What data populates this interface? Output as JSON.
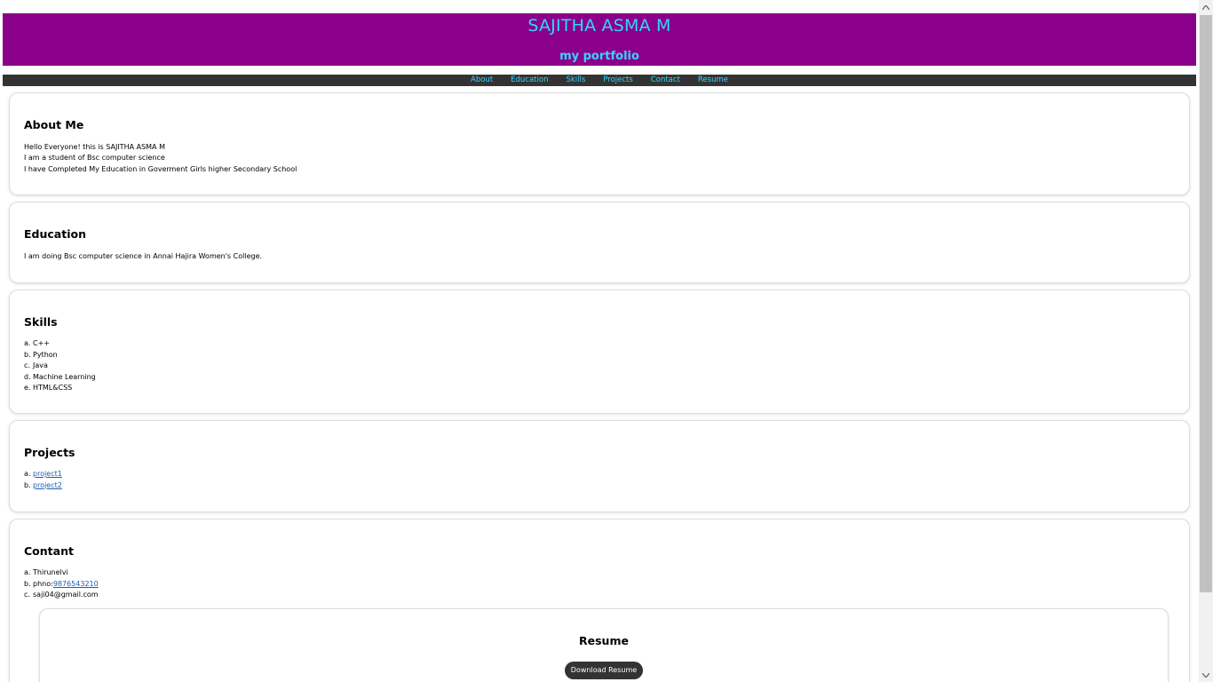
{
  "header": {
    "title": "SAJITHA ASMA M",
    "subtitle": "my portfolio"
  },
  "nav": {
    "items": [
      {
        "label": "About"
      },
      {
        "label": "Education"
      },
      {
        "label": "Skills"
      },
      {
        "label": "Projects"
      },
      {
        "label": "Contact"
      },
      {
        "label": "Resume"
      }
    ]
  },
  "about": {
    "heading": "About Me",
    "lines": [
      "Hello Everyone! this is SAJITHA ASMA M",
      "I am a student of Bsc computer science",
      "I have Completed My Education in Goverment Girls higher Secondary School"
    ]
  },
  "education": {
    "heading": "Education",
    "text": "I am doing Bsc computer science in Annai Hajira Women's College."
  },
  "skills": {
    "heading": "Skills",
    "items": [
      {
        "marker": "a.",
        "label": "C++"
      },
      {
        "marker": "b.",
        "label": "Python"
      },
      {
        "marker": "c.",
        "label": "Java"
      },
      {
        "marker": "d.",
        "label": "Machine Learning"
      },
      {
        "marker": "e.",
        "label": "HTML&CSS"
      }
    ]
  },
  "projects": {
    "heading": "Projects",
    "items": [
      {
        "marker": "a.",
        "label": "project1"
      },
      {
        "marker": "b.",
        "label": "project2"
      }
    ]
  },
  "contact": {
    "heading": "Contant",
    "items": [
      {
        "marker": "a.",
        "label": "Thirunelvi"
      },
      {
        "marker": "b.",
        "prefix": "phno:",
        "link": "9876543210"
      },
      {
        "marker": "c.",
        "label": "saji04@gmail.com"
      }
    ]
  },
  "resume": {
    "heading": "Resume",
    "button_label": "Download Resume"
  },
  "colors": {
    "banner_bg": "#8b008b",
    "banner_text": "#33d6ff",
    "nav_bg": "#333333",
    "nav_text": "#33d6ff",
    "link": "#1a5fb4",
    "button_bg": "#333333"
  }
}
